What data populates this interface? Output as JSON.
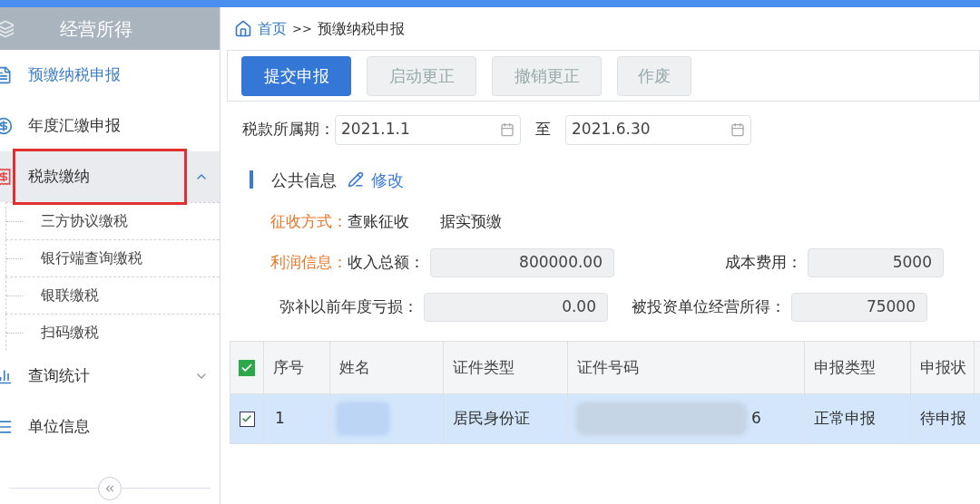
{
  "sidebar": {
    "title": "经营所得",
    "items": [
      {
        "label": "预缴纳税申报",
        "selected": true,
        "highlighted": false
      },
      {
        "label": "年度汇缴申报",
        "selected": false,
        "highlighted": false
      },
      {
        "label": "税款缴纳",
        "selected": false,
        "highlighted": true,
        "expanded": true,
        "children": [
          {
            "label": "三方协议缴税"
          },
          {
            "label": "银行端查询缴税"
          },
          {
            "label": "银联缴税"
          },
          {
            "label": "扫码缴税"
          }
        ]
      },
      {
        "label": "查询统计",
        "selected": false,
        "highlighted": false,
        "expanded": false
      },
      {
        "label": "单位信息",
        "selected": false,
        "highlighted": false
      }
    ]
  },
  "breadcrumb": {
    "home": "首页",
    "separator": ">>",
    "current": "预缴纳税申报"
  },
  "toolbar": [
    {
      "label": "提交申报",
      "disabled": false
    },
    {
      "label": "启动更正",
      "disabled": true
    },
    {
      "label": "撤销更正",
      "disabled": true
    },
    {
      "label": "作废",
      "disabled": true
    }
  ],
  "period": {
    "label": "税款所属期：",
    "from": "2021.1.1",
    "to_label": "至",
    "to": "2021.6.30"
  },
  "public_info": {
    "title": "公共信息",
    "edit": "修改",
    "collection": {
      "label": "征收方式：",
      "values": [
        "查账征收",
        "据实预缴"
      ]
    },
    "profit": {
      "label": "利润信息：",
      "fields": [
        {
          "label": "收入总额：",
          "value": "800000.00"
        },
        {
          "label": "成本费用：",
          "value": "5000"
        }
      ]
    },
    "second_row": [
      {
        "label": "弥补以前年度亏损：",
        "value": "0.00"
      },
      {
        "label": "被投资单位经营所得：",
        "value": "75000"
      }
    ]
  },
  "table": {
    "all_checked": true,
    "columns": [
      "序号",
      "姓名",
      "证件类型",
      "证件号码",
      "申报类型",
      "申报状"
    ],
    "rows": [
      {
        "checked": true,
        "selected": true,
        "number": "1",
        "id_type": "居民身份证",
        "id_tail": "6",
        "type": "正常申报",
        "status": "待申报"
      }
    ]
  }
}
